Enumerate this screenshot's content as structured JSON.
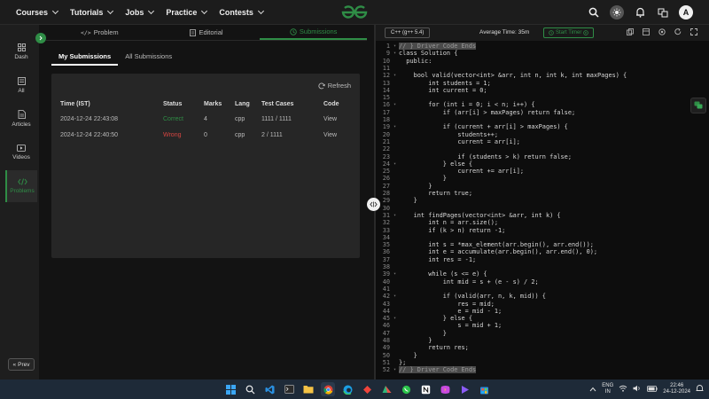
{
  "nav": {
    "items": [
      {
        "label": "Courses"
      },
      {
        "label": "Tutorials"
      },
      {
        "label": "Jobs"
      },
      {
        "label": "Practice"
      },
      {
        "label": "Contests"
      }
    ],
    "avatar_letter": "A"
  },
  "rail": {
    "items": [
      {
        "label": "Dash",
        "icon": "dashboard-icon"
      },
      {
        "label": "All",
        "icon": "all-icon"
      },
      {
        "label": "Articles",
        "icon": "articles-icon"
      },
      {
        "label": "Videos",
        "icon": "videos-icon"
      },
      {
        "label": "Problems",
        "icon": "problems-icon"
      }
    ],
    "prev_label": "Prev"
  },
  "tabs": [
    {
      "label": "Problem",
      "icon": "code-icon"
    },
    {
      "label": "Editorial",
      "icon": "editorial-icon"
    },
    {
      "label": "Submissions",
      "icon": "clock-icon"
    }
  ],
  "subtabs": [
    {
      "label": "My Submissions"
    },
    {
      "label": "All Submissions"
    }
  ],
  "submissions": {
    "refresh_label": "Refresh",
    "columns": [
      "Time (IST)",
      "Status",
      "Marks",
      "Lang",
      "Test Cases",
      "Code"
    ],
    "rows": [
      {
        "time": "2024-12-24 22:43:08",
        "status": "Correct",
        "marks": "4",
        "lang": "cpp",
        "tests": "1111 / 1111",
        "code": "View"
      },
      {
        "time": "2024-12-24 22:40:50",
        "status": "Wrong",
        "marks": "0",
        "lang": "cpp",
        "tests": "2 / 1111",
        "code": "View"
      }
    ]
  },
  "editor": {
    "language": "C++ (g++ 5.4)",
    "average_time": "Average Time: 35m",
    "timer_label": "Start Timer",
    "lines": [
      {
        "n": "1",
        "text": "// } Driver Code Ends",
        "hl": true
      },
      {
        "n": "9",
        "text": "class Solution {"
      },
      {
        "n": "10",
        "text": "  public:"
      },
      {
        "n": "11",
        "text": ""
      },
      {
        "n": "12",
        "text": "    bool valid(vector<int> &arr, int n, int k, int maxPages) {"
      },
      {
        "n": "13",
        "text": "        int students = 1;"
      },
      {
        "n": "14",
        "text": "        int current = 0;"
      },
      {
        "n": "15",
        "text": ""
      },
      {
        "n": "16",
        "text": "        for (int i = 0; i < n; i++) {"
      },
      {
        "n": "17",
        "text": "            if (arr[i] > maxPages) return false;"
      },
      {
        "n": "18",
        "text": ""
      },
      {
        "n": "19",
        "text": "            if (current + arr[i] > maxPages) {"
      },
      {
        "n": "20",
        "text": "                students++;"
      },
      {
        "n": "21",
        "text": "                current = arr[i];"
      },
      {
        "n": "22",
        "text": ""
      },
      {
        "n": "23",
        "text": "                if (students > k) return false;"
      },
      {
        "n": "24",
        "text": "            } else {"
      },
      {
        "n": "25",
        "text": "                current += arr[i];"
      },
      {
        "n": "26",
        "text": "            }"
      },
      {
        "n": "27",
        "text": "        }"
      },
      {
        "n": "28",
        "text": "        return true;"
      },
      {
        "n": "29",
        "text": "    }"
      },
      {
        "n": "30",
        "text": ""
      },
      {
        "n": "31",
        "text": "    int findPages(vector<int> &arr, int k) {"
      },
      {
        "n": "32",
        "text": "        int n = arr.size();"
      },
      {
        "n": "33",
        "text": "        if (k > n) return -1;"
      },
      {
        "n": "34",
        "text": ""
      },
      {
        "n": "35",
        "text": "        int s = *max_element(arr.begin(), arr.end());"
      },
      {
        "n": "36",
        "text": "        int e = accumulate(arr.begin(), arr.end(), 0);"
      },
      {
        "n": "37",
        "text": "        int res = -1;"
      },
      {
        "n": "38",
        "text": ""
      },
      {
        "n": "39",
        "text": "        while (s <= e) {"
      },
      {
        "n": "40",
        "text": "            int mid = s + (e - s) / 2;"
      },
      {
        "n": "41",
        "text": ""
      },
      {
        "n": "42",
        "text": "            if (valid(arr, n, k, mid)) {"
      },
      {
        "n": "43",
        "text": "                res = mid;"
      },
      {
        "n": "44",
        "text": "                e = mid - 1;"
      },
      {
        "n": "45",
        "text": "            } else {"
      },
      {
        "n": "46",
        "text": "                s = mid + 1;"
      },
      {
        "n": "47",
        "text": "            }"
      },
      {
        "n": "48",
        "text": "        }"
      },
      {
        "n": "49",
        "text": "        return res;"
      },
      {
        "n": "50",
        "text": "    }"
      },
      {
        "n": "51",
        "text": "};"
      },
      {
        "n": "52",
        "text": "// } Driver Code Ends",
        "hl": true
      }
    ]
  },
  "taskbar": {
    "lang_line1": "ENG",
    "lang_line2": "IN",
    "time": "22:46",
    "date": "24-12-2024"
  },
  "colors": {
    "accent": "#2f8d46",
    "wrong": "#d64541",
    "bg": "#131313",
    "card": "#262626",
    "editor_bg": "#0d0d0d"
  }
}
